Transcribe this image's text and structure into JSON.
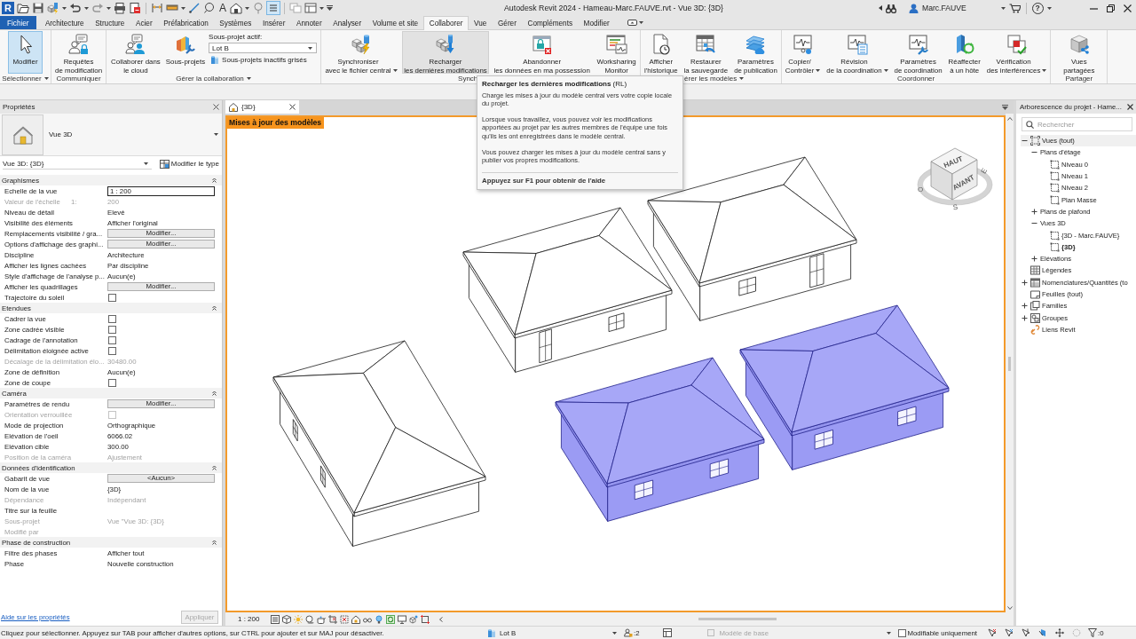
{
  "title_bar": {
    "logo": "R",
    "text_tool": "A",
    "thin_lines_active": true,
    "title": "Autodesk Revit 2024 - Hameau-Marc.FAUVE.rvt - Vue 3D: {3D}",
    "user": "Marc.FAUVE",
    "help": "?"
  },
  "tabs": [
    {
      "label": "Fichier",
      "kind": "file",
      "selected": false
    },
    {
      "label": "Architecture",
      "kind": "tab",
      "selected": false
    },
    {
      "label": "Structure",
      "kind": "tab",
      "selected": false
    },
    {
      "label": "Acier",
      "kind": "tab",
      "selected": false
    },
    {
      "label": "Préfabrication",
      "kind": "tab",
      "selected": false
    },
    {
      "label": "Systèmes",
      "kind": "tab",
      "selected": false
    },
    {
      "label": "Insérer",
      "kind": "tab",
      "selected": false
    },
    {
      "label": "Annoter",
      "kind": "tab",
      "selected": false
    },
    {
      "label": "Analyser",
      "kind": "tab",
      "selected": false
    },
    {
      "label": "Volume et site",
      "kind": "tab",
      "selected": false
    },
    {
      "label": "Collaborer",
      "kind": "tab",
      "selected": true
    },
    {
      "label": "Vue",
      "kind": "tab",
      "selected": false
    },
    {
      "label": "Gérer",
      "kind": "tab",
      "selected": false
    },
    {
      "label": "Compléments",
      "kind": "tab",
      "selected": false
    },
    {
      "label": "Modifier",
      "kind": "tab",
      "selected": false
    }
  ],
  "ribbon": {
    "groups": [
      {
        "label": "Sélectionner",
        "menu": true,
        "items": [
          {
            "kind": "large",
            "lines": [
              "Modifier"
            ],
            "menu": false,
            "selected": true,
            "hovered": false
          }
        ]
      },
      {
        "label": "Communiquer",
        "menu": false,
        "items": [
          {
            "kind": "large",
            "lines": [
              "Requêtes",
              "de modification"
            ],
            "menu": false,
            "selected": false,
            "hovered": false
          }
        ]
      },
      {
        "label": "Gérer la collaboration",
        "menu": true,
        "items": [
          {
            "kind": "large",
            "lines": [
              "Collaborer dans",
              "le cloud"
            ],
            "menu": false,
            "selected": false,
            "hovered": false
          },
          {
            "kind": "large",
            "lines": [
              "Sous-projets"
            ],
            "menu": false,
            "selected": false,
            "hovered": false
          },
          {
            "kind": "workset",
            "caption": "Sous-projet actif:",
            "value": "Lot B",
            "toggle": "Sous-projets inactifs grisés"
          }
        ]
      },
      {
        "label": "Synch",
        "menu": false,
        "items": [
          {
            "kind": "large",
            "lines": [
              "Synchroniser",
              "avec le fichier central"
            ],
            "menu": true,
            "selected": false,
            "hovered": false
          },
          {
            "kind": "large",
            "lines": [
              "Recharger",
              "les dernières modifications"
            ],
            "menu": false,
            "selected": false,
            "hovered": true
          },
          {
            "kind": "large",
            "lines": [
              "Abandonner",
              "les données en ma possession"
            ],
            "menu": false,
            "selected": false,
            "hovered": false
          },
          {
            "kind": "large",
            "lines": [
              "Worksharing",
              "Monitor"
            ],
            "menu": false,
            "selected": false,
            "hovered": false
          }
        ]
      },
      {
        "label": "érer les modèles",
        "menu": true,
        "items": [
          {
            "kind": "large",
            "lines": [
              "Afficher",
              "l'historique"
            ],
            "menu": false,
            "selected": false,
            "hovered": false
          },
          {
            "kind": "large",
            "lines": [
              "Restaurer",
              "la sauvegarde"
            ],
            "menu": false,
            "selected": false,
            "hovered": false
          },
          {
            "kind": "large",
            "lines": [
              "Paramètres",
              "de publication"
            ],
            "menu": false,
            "selected": false,
            "hovered": false
          }
        ]
      },
      {
        "label": "Coordonner",
        "menu": false,
        "items": [
          {
            "kind": "large",
            "lines": [
              "Copier/",
              "Contrôler"
            ],
            "menu": true,
            "selected": false,
            "hovered": false
          },
          {
            "kind": "large",
            "lines": [
              "Révision",
              "de la coordination"
            ],
            "menu": true,
            "selected": false,
            "hovered": false
          },
          {
            "kind": "large",
            "lines": [
              "Paramètres",
              "de coordination"
            ],
            "menu": false,
            "selected": false,
            "hovered": false
          },
          {
            "kind": "large",
            "lines": [
              "Réaffecter",
              "à un hôte"
            ],
            "menu": false,
            "selected": false,
            "hovered": false
          },
          {
            "kind": "large",
            "lines": [
              "Vérification",
              "des interférences"
            ],
            "menu": true,
            "selected": false,
            "hovered": false
          }
        ]
      },
      {
        "label": "Partager",
        "menu": false,
        "items": [
          {
            "kind": "large",
            "lines": [
              "Vues",
              "partagées"
            ],
            "menu": false,
            "selected": false,
            "hovered": false
          }
        ]
      }
    ]
  },
  "tooltip": {
    "title": "**Recharger les dernières modifications** (RL)",
    "paragraphs": [
      "Charge les mises à jour du modèle central vers votre copie locale du projet.",
      "Lorsque vous travaillez, vous pouvez voir les modifications apportées au projet par les autres membres de l'équipe une fois qu'ils les ont enregistrées dans le modèle central.",
      "Vous pouvez charger les mises à jour du modèle central sans y publier vos propres modifications."
    ],
    "help": "Appuyez sur F1 pour obtenir de l'aide"
  },
  "properties": {
    "title": "Propriétés",
    "type": "Vue 3D",
    "instance": "Vue 3D: {3D}",
    "edit_type": "Modifier le type",
    "groups": [
      {
        "name": "Graphismes",
        "expanded": true,
        "rows": [
          {
            "kind": "field",
            "name": "Echelle de la vue",
            "value": "1 : 200",
            "disabled": false
          },
          {
            "kind": "text",
            "name": "Valeur de l'échelle",
            "prefix": "1:",
            "value": "200",
            "disabled": true
          },
          {
            "kind": "text",
            "name": "Niveau de détail",
            "value": "Elevé",
            "disabled": false
          },
          {
            "kind": "text",
            "name": "Visibilité des éléments",
            "value": "Afficher l'original",
            "disabled": false
          },
          {
            "kind": "button",
            "name": "Remplacements visibilité / gra...",
            "value": "Modifier...",
            "disabled": false
          },
          {
            "kind": "button",
            "name": "Options d'affichage des graphi...",
            "value": "Modifier...",
            "disabled": false
          },
          {
            "kind": "text",
            "name": "Discipline",
            "value": "Architecture",
            "disabled": false
          },
          {
            "kind": "text",
            "name": "Afficher les lignes cachées",
            "value": "Par discipline",
            "disabled": false
          },
          {
            "kind": "text",
            "name": "Style d'affichage de l'analyse p...",
            "value": "Aucun(e)",
            "disabled": false
          },
          {
            "kind": "button",
            "name": "Afficher les quadrillages",
            "value": "Modifier...",
            "disabled": false
          },
          {
            "kind": "checkbox",
            "name": "Trajectoire du soleil",
            "checked": false,
            "disabled": false
          }
        ]
      },
      {
        "name": "Etendues",
        "expanded": true,
        "rows": [
          {
            "kind": "checkbox",
            "name": "Cadrer la vue",
            "checked": false,
            "disabled": false
          },
          {
            "kind": "checkbox",
            "name": "Zone cadrée visible",
            "checked": false,
            "disabled": false
          },
          {
            "kind": "checkbox",
            "name": "Cadrage de l'annotation",
            "checked": false,
            "disabled": false
          },
          {
            "kind": "checkbox",
            "name": "Délimitation éloignée active",
            "checked": false,
            "disabled": false
          },
          {
            "kind": "text",
            "name": "Décalage de la délimitation élo...",
            "value": "30480.00",
            "disabled": true
          },
          {
            "kind": "text",
            "name": "Zone de définition",
            "value": "Aucun(e)",
            "disabled": false
          },
          {
            "kind": "checkbox",
            "name": "Zone de coupe",
            "checked": false,
            "disabled": false
          }
        ]
      },
      {
        "name": "Caméra",
        "expanded": true,
        "rows": [
          {
            "kind": "button",
            "name": "Paramètres de rendu",
            "value": "Modifier...",
            "disabled": false
          },
          {
            "kind": "checkbox",
            "name": "Orientation verrouillée",
            "checked": false,
            "disabled": true
          },
          {
            "kind": "text",
            "name": "Mode de projection",
            "value": "Orthographique",
            "disabled": false
          },
          {
            "kind": "text",
            "name": "Elévation de l'oeil",
            "value": "6066.02",
            "disabled": false
          },
          {
            "kind": "text",
            "name": "Elévation cible",
            "value": "300.00",
            "disabled": false
          },
          {
            "kind": "text",
            "name": "Position de la caméra",
            "value": "Ajustement",
            "disabled": true
          }
        ]
      },
      {
        "name": "Données d'identification",
        "expanded": true,
        "rows": [
          {
            "kind": "button",
            "name": "Gabarit de vue",
            "value": "<Aucun>",
            "disabled": false
          },
          {
            "kind": "text",
            "name": "Nom de la vue",
            "value": "{3D}",
            "disabled": false
          },
          {
            "kind": "text",
            "name": "Dépendance",
            "value": "Indépendant",
            "disabled": true
          },
          {
            "kind": "text",
            "name": "Titre sur la feuille",
            "disabled": false
          },
          {
            "kind": "text",
            "name": "Sous-projet",
            "value": "Vue \"Vue 3D: {3D}",
            "disabled": true
          },
          {
            "kind": "text",
            "name": "Modifié par",
            "disabled": true
          }
        ]
      },
      {
        "name": "Phase de construction",
        "expanded": true,
        "rows": [
          {
            "kind": "text",
            "name": "Filtre des phases",
            "value": "Afficher tout",
            "disabled": false
          },
          {
            "kind": "text",
            "name": "Phase",
            "value": "Nouvelle construction",
            "disabled": false
          }
        ]
      }
    ],
    "help_link": "Aide sur les propriétés",
    "apply": {
      "label": "Appliquer",
      "disabled": true
    }
  },
  "view": {
    "tab": "{3D}",
    "banner": "Mises à jour des modèles",
    "viewcube": {
      "top": "HAUT",
      "front": "AVANT",
      "compass": [
        "O",
        "S",
        "E"
      ]
    },
    "models": [
      {
        "highlighted": false
      },
      {
        "highlighted": false
      },
      {
        "highlighted": false
      },
      {
        "highlighted": true
      },
      {
        "highlighted": true
      }
    ],
    "scale": "1 : 200"
  },
  "project_browser": {
    "title": "Arborescence du projet - Hame...",
    "search": {
      "placeholder": "Rechercher"
    },
    "tree": [
      {
        "label": "Vues (tout)",
        "kind": "views",
        "expanded": true,
        "children": [
          {
            "label": "Plans d'étage",
            "kind": "folder",
            "expanded": true,
            "children": [
              {
                "label": "Niveau 0",
                "kind": "view",
                "active": false
              },
              {
                "label": "Niveau 1",
                "kind": "view",
                "active": false
              },
              {
                "label": "Niveau 2",
                "kind": "view",
                "active": false
              },
              {
                "label": "Plan Masse",
                "kind": "view",
                "active": false
              }
            ]
          },
          {
            "label": "Plans de plafond",
            "kind": "folder",
            "expanded": false
          },
          {
            "label": "Vues 3D",
            "kind": "folder",
            "expanded": true,
            "children": [
              {
                "label": "{3D - Marc.FAUVE}",
                "kind": "view",
                "active": false
              },
              {
                "label": "{3D}",
                "kind": "view",
                "active": true
              }
            ]
          },
          {
            "label": "Elévations",
            "kind": "folder",
            "expanded": false
          }
        ]
      },
      {
        "label": "Légendes",
        "kind": "legends"
      },
      {
        "label": "Nomenclatures/Quantités (to",
        "kind": "schedules",
        "expanded": false
      },
      {
        "label": "Feuilles (tout)",
        "kind": "sheets"
      },
      {
        "label": "Familles",
        "kind": "families",
        "expanded": false
      },
      {
        "label": "Groupes",
        "kind": "groups",
        "expanded": false
      },
      {
        "label": "Liens Revit",
        "kind": "links"
      }
    ]
  },
  "status_bar": {
    "message": "Cliquez pour sélectionner. Appuyez sur TAB pour afficher d'autres options, sur CTRL pour ajouter et sur MAJ pour désactiver.",
    "workset": "Lot B",
    "editors": ":2",
    "design_option": {
      "value": "Modèle de base",
      "disabled": true
    },
    "editable_only": {
      "label": "Modifiable uniquement",
      "checked": false
    },
    "filter": ":0"
  }
}
